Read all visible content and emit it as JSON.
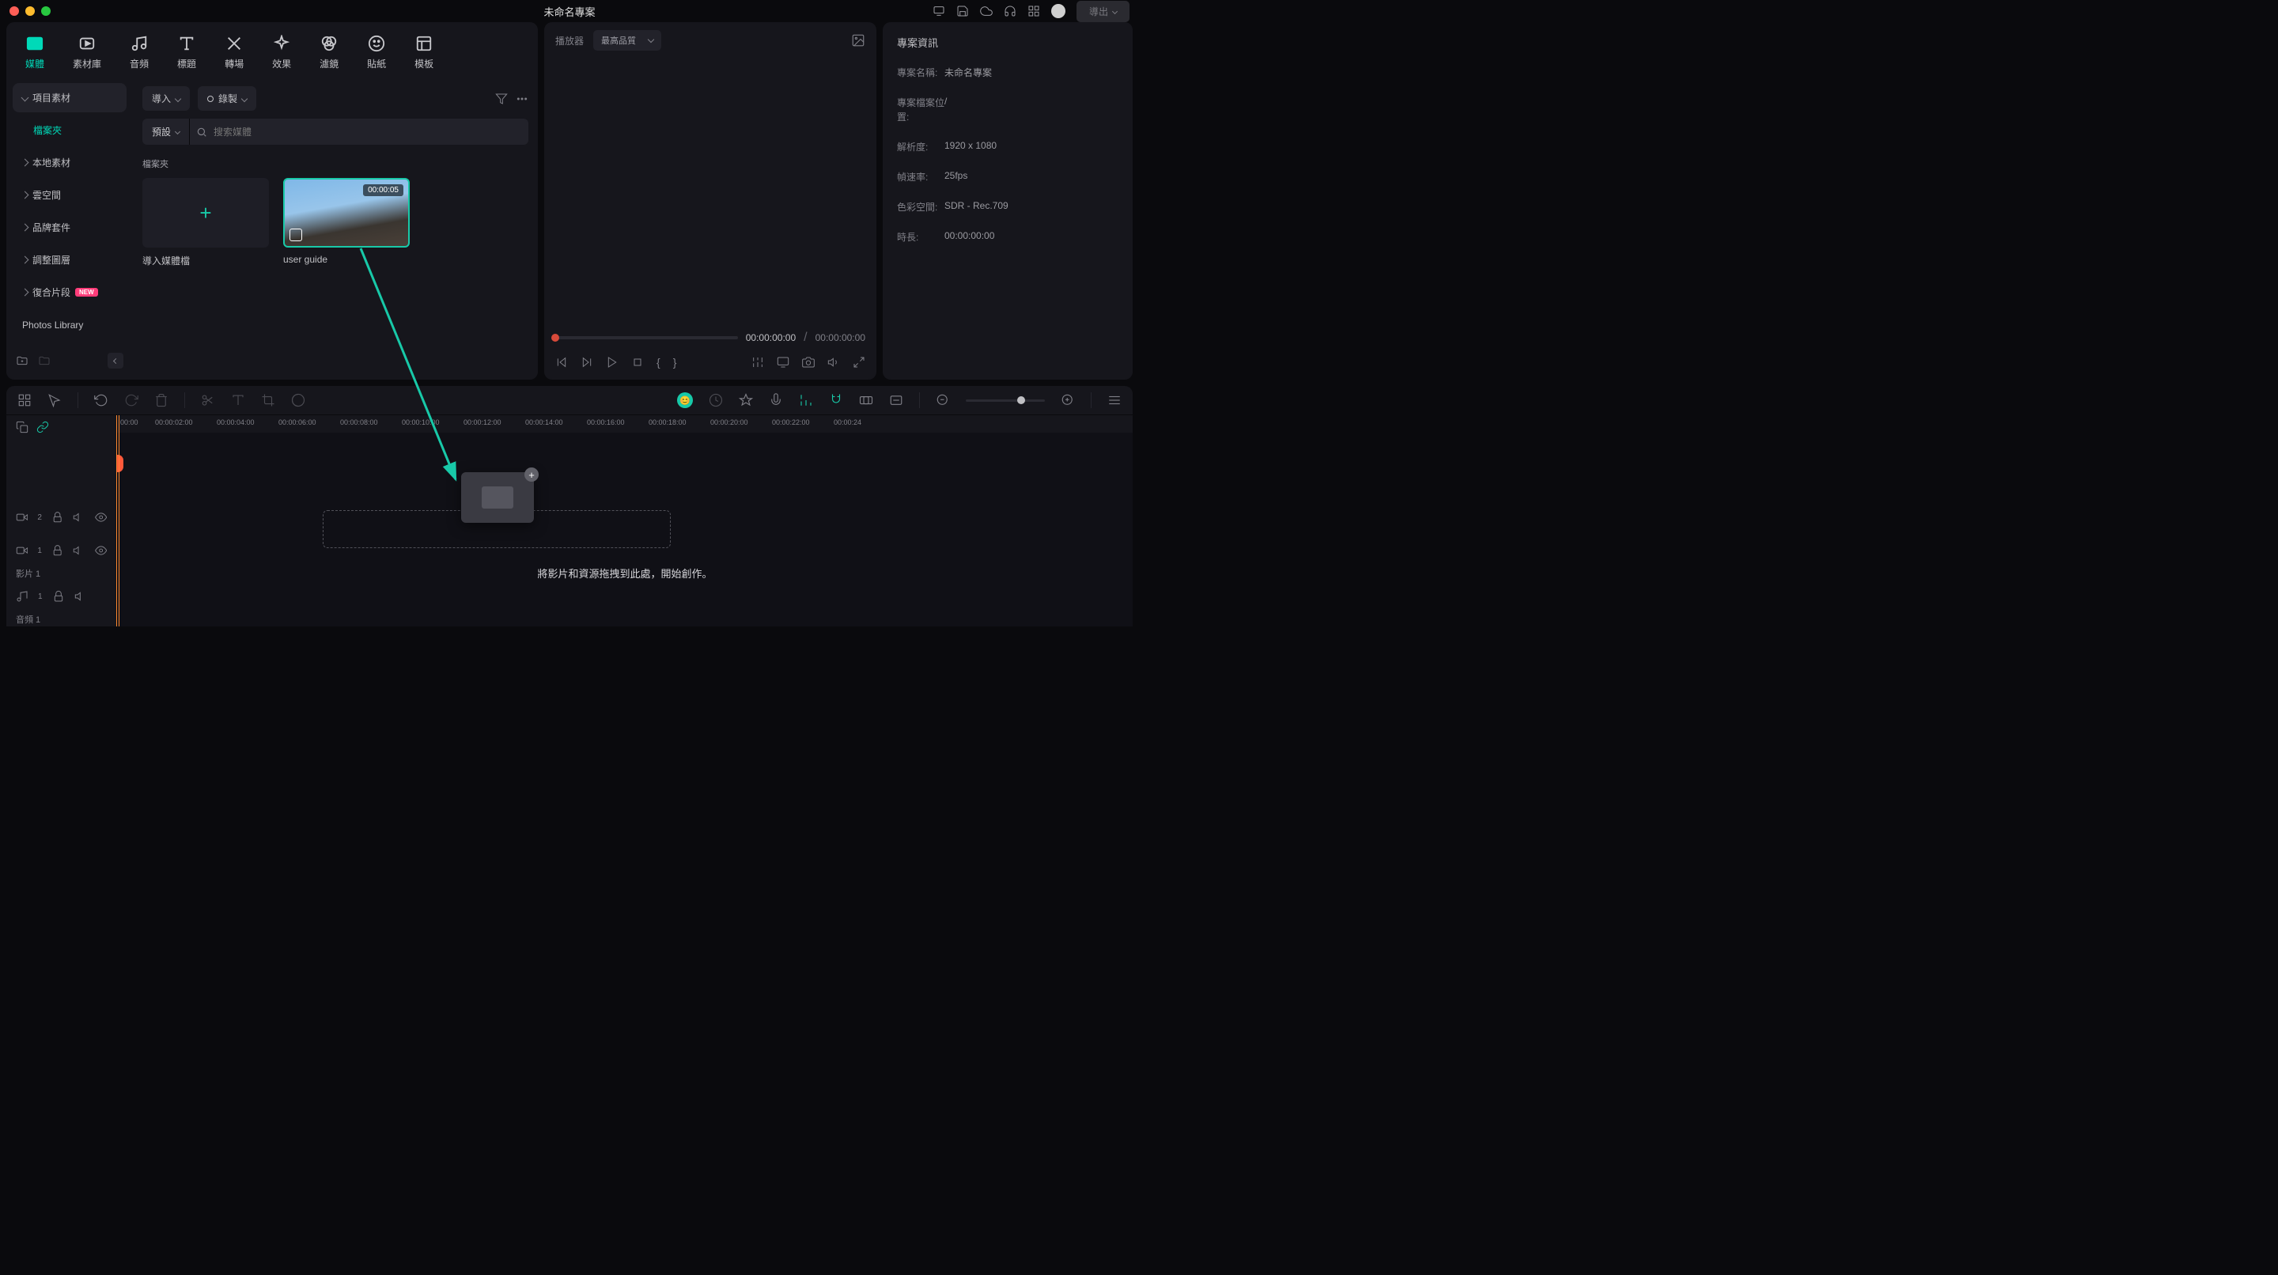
{
  "titlebar": {
    "title": "未命名專案",
    "export_label": "導出"
  },
  "top_tabs": [
    {
      "label": "媒體",
      "active": true
    },
    {
      "label": "素材庫",
      "active": false
    },
    {
      "label": "音頻",
      "active": false
    },
    {
      "label": "標題",
      "active": false
    },
    {
      "label": "轉場",
      "active": false
    },
    {
      "label": "效果",
      "active": false
    },
    {
      "label": "濾鏡",
      "active": false
    },
    {
      "label": "貼紙",
      "active": false
    },
    {
      "label": "模板",
      "active": false
    }
  ],
  "sidebar": {
    "items": [
      {
        "label": "項目素材",
        "type": "header"
      },
      {
        "label": "檔案夾",
        "type": "sub"
      },
      {
        "label": "本地素材",
        "type": "item"
      },
      {
        "label": "雲空間",
        "type": "item"
      },
      {
        "label": "品牌套件",
        "type": "item"
      },
      {
        "label": "調整圖層",
        "type": "item"
      },
      {
        "label": "復合片段",
        "type": "item",
        "badge": "NEW"
      },
      {
        "label": "Photos Library",
        "type": "photos"
      }
    ]
  },
  "media_toolbar": {
    "import_label": "導入",
    "record_label": "錄製"
  },
  "search": {
    "prefix": "預設",
    "placeholder": "搜索媒體"
  },
  "folder_heading": "檔案夾",
  "media_items": [
    {
      "type": "import",
      "label": "導入媒體檔"
    },
    {
      "type": "clip",
      "label": "user guide",
      "duration": "00:00:05"
    }
  ],
  "preview": {
    "header_label": "播放器",
    "quality": "最高品質",
    "current_time": "00:00:00:00",
    "total_time": "00:00:00:00"
  },
  "info_panel": {
    "title": "專案資訊",
    "rows": [
      {
        "label": "專案名稱:",
        "value": "未命名專案"
      },
      {
        "label": "專案檔案位置:",
        "value": "/"
      },
      {
        "label": "解析度:",
        "value": "1920 x 1080"
      },
      {
        "label": "幀速率:",
        "value": "25fps"
      },
      {
        "label": "色彩空間:",
        "value": "SDR - Rec.709"
      },
      {
        "label": "時長:",
        "value": "00:00:00:00"
      }
    ]
  },
  "timeline": {
    "ruler": [
      "00:00",
      "00:00:02:00",
      "00:00:04:00",
      "00:00:06:00",
      "00:00:08:00",
      "00:00:10:00",
      "00:00:12:00",
      "00:00:14:00",
      "00:00:16:00",
      "00:00:18:00",
      "00:00:20:00",
      "00:00:22:00",
      "00:00:24"
    ],
    "tracks": [
      {
        "icon": "video",
        "num": "2"
      },
      {
        "icon": "video",
        "num": "1",
        "label": "影片 1"
      },
      {
        "icon": "audio",
        "num": "1",
        "label": "音頻 1"
      }
    ],
    "drop_hint": "將影片和資源拖拽到此處，開始創作。"
  }
}
